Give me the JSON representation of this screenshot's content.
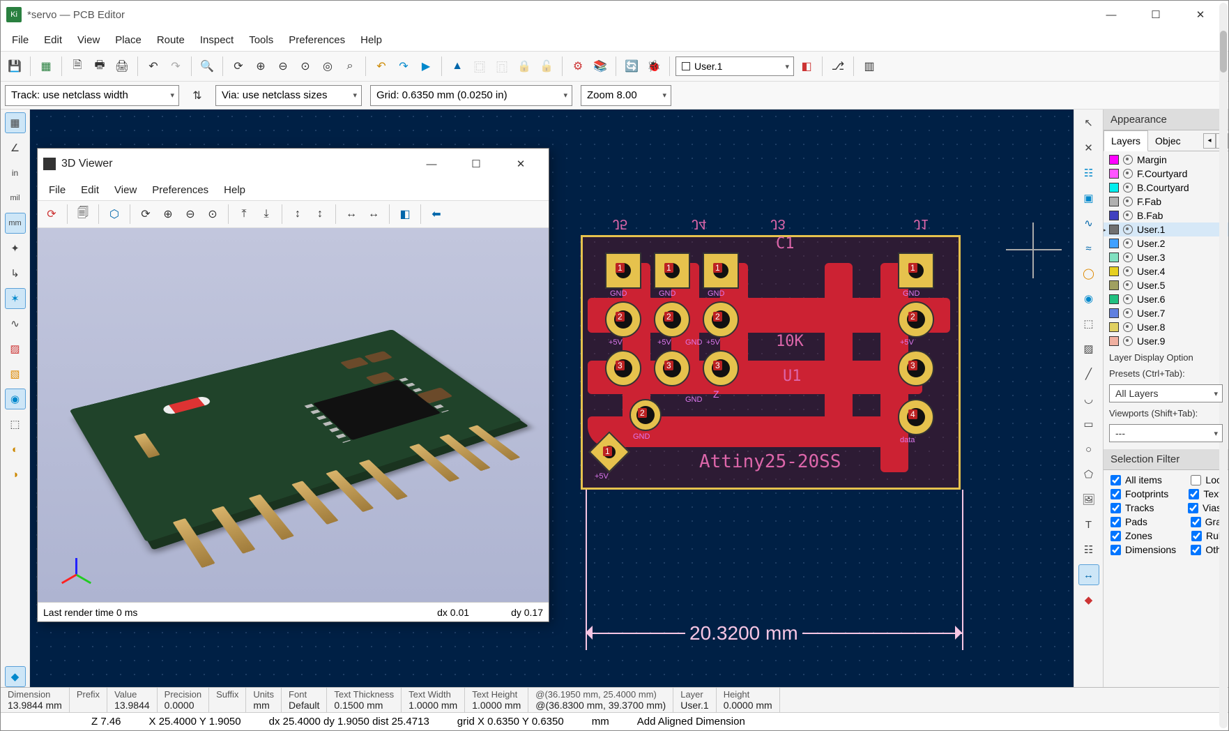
{
  "window": {
    "title": "*servo — PCB Editor"
  },
  "menubar": [
    "File",
    "Edit",
    "View",
    "Place",
    "Route",
    "Inspect",
    "Tools",
    "Preferences",
    "Help"
  ],
  "toolbar": {
    "layer_combo": "User.1"
  },
  "toolbar2": {
    "track": "Track: use netclass width",
    "via": "Via: use netclass sizes",
    "grid": "Grid: 0.6350 mm (0.0250 in)",
    "zoom": "Zoom 8.00"
  },
  "left_tools": [
    "grid",
    "polar",
    "in",
    "mil",
    "mm",
    "snap",
    "axis",
    "ratsnest",
    "ratsnest-curve",
    "zone-fill",
    "zone-outline",
    "pad-fill",
    "pad-number",
    "contrast",
    "layer-manager"
  ],
  "right_tools": [
    "select",
    "net-highlight",
    "clearance",
    "ratsnest-tool",
    "route",
    "route-diff",
    "via",
    "arc",
    "filled-zone",
    "rule-area",
    "line",
    "arc2",
    "circle",
    "rect",
    "polygon",
    "image",
    "text",
    "textbox",
    "dimension-h",
    "dimension-ruler"
  ],
  "appearance": {
    "title": "Appearance",
    "tabs": [
      "Layers",
      "Objec"
    ],
    "layers": [
      {
        "name": "Margin",
        "color": "#ff00ff"
      },
      {
        "name": "F.Courtyard",
        "color": "#ff55ff"
      },
      {
        "name": "B.Courtyard",
        "color": "#00eeee"
      },
      {
        "name": "F.Fab",
        "color": "#b0b0b0"
      },
      {
        "name": "B.Fab",
        "color": "#4040c0"
      },
      {
        "name": "User.1",
        "color": "#707070",
        "selected": true
      },
      {
        "name": "User.2",
        "color": "#40a0ff"
      },
      {
        "name": "User.3",
        "color": "#80e0c0"
      },
      {
        "name": "User.4",
        "color": "#e6d020"
      },
      {
        "name": "User.5",
        "color": "#a0a060"
      },
      {
        "name": "User.6",
        "color": "#20c080"
      },
      {
        "name": "User.7",
        "color": "#6080e0"
      },
      {
        "name": "User.8",
        "color": "#e0d060"
      },
      {
        "name": "User.9",
        "color": "#f0b0a0"
      }
    ],
    "display_options": "Layer Display Option",
    "presets_label": "Presets (Ctrl+Tab):",
    "presets_value": "All Layers",
    "viewports_label": "Viewports (Shift+Tab):",
    "viewports_value": "---"
  },
  "selection_filter": {
    "title": "Selection Filter",
    "left": [
      "All items",
      "Footprints",
      "Tracks",
      "Pads",
      "Zones",
      "Dimensions"
    ],
    "right": [
      "Loc",
      "Text",
      "Vias",
      "Gra",
      "Rul",
      "Oth"
    ]
  },
  "viewer3d": {
    "title": "3D Viewer",
    "menus": [
      "File",
      "Edit",
      "View",
      "Preferences",
      "Help"
    ],
    "status_render": "Last render time 0 ms",
    "status_dx": "dx 0.01",
    "status_dy": "dy 0.17"
  },
  "pcb": {
    "refs_top": [
      "J5",
      "J4",
      "J3",
      "",
      "J1"
    ],
    "c1": "C1",
    "r_label": "10K",
    "u1": "U1",
    "chip": "Attiny25-20SS",
    "net_gnd": "GND",
    "net_5v": "+5V",
    "net_z": "Z",
    "net_data": "data",
    "dim_value": "20.3200",
    "dim_unit": "mm"
  },
  "status1": {
    "cells": [
      {
        "lbl": "Dimension",
        "val": "13.9844 mm"
      },
      {
        "lbl": "Prefix",
        "val": ""
      },
      {
        "lbl": "Value",
        "val": "13.9844"
      },
      {
        "lbl": "Precision",
        "val": "0.0000"
      },
      {
        "lbl": "Suffix",
        "val": ""
      },
      {
        "lbl": "Units",
        "val": "mm"
      },
      {
        "lbl": "Font",
        "val": "Default"
      },
      {
        "lbl": "Text Thickness",
        "val": "0.1500 mm"
      },
      {
        "lbl": "Text Width",
        "val": "1.0000 mm"
      },
      {
        "lbl": "Text Height",
        "val": "1.0000 mm"
      },
      {
        "lbl": "@(36.1950 mm, 25.4000 mm)",
        "val": "@(36.8300 mm, 39.3700 mm)"
      },
      {
        "lbl": "Layer",
        "val": "User.1"
      },
      {
        "lbl": "Height",
        "val": "0.0000 mm"
      }
    ]
  },
  "status2": {
    "z": "Z 7.46",
    "xy": "X 25.4000  Y 1.9050",
    "dxy": "dx 25.4000  dy 1.9050  dist 25.4713",
    "grid": "grid X 0.6350  Y 0.6350",
    "unit": "mm",
    "mode": "Add Aligned Dimension"
  }
}
